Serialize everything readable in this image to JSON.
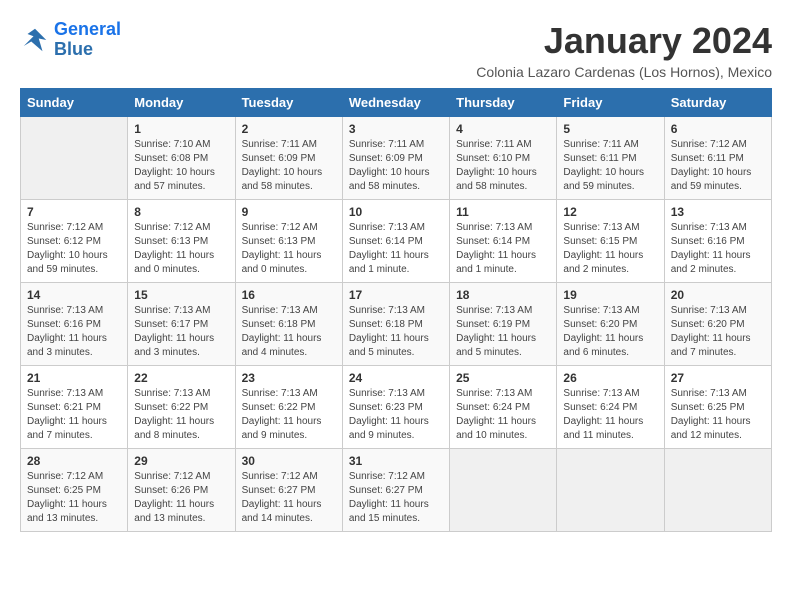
{
  "logo": {
    "line1": "General",
    "line2": "Blue"
  },
  "title": "January 2024",
  "location": "Colonia Lazaro Cardenas (Los Hornos), Mexico",
  "days_of_week": [
    "Sunday",
    "Monday",
    "Tuesday",
    "Wednesday",
    "Thursday",
    "Friday",
    "Saturday"
  ],
  "weeks": [
    [
      {
        "day": "",
        "info": ""
      },
      {
        "day": "1",
        "info": "Sunrise: 7:10 AM\nSunset: 6:08 PM\nDaylight: 10 hours\nand 57 minutes."
      },
      {
        "day": "2",
        "info": "Sunrise: 7:11 AM\nSunset: 6:09 PM\nDaylight: 10 hours\nand 58 minutes."
      },
      {
        "day": "3",
        "info": "Sunrise: 7:11 AM\nSunset: 6:09 PM\nDaylight: 10 hours\nand 58 minutes."
      },
      {
        "day": "4",
        "info": "Sunrise: 7:11 AM\nSunset: 6:10 PM\nDaylight: 10 hours\nand 58 minutes."
      },
      {
        "day": "5",
        "info": "Sunrise: 7:11 AM\nSunset: 6:11 PM\nDaylight: 10 hours\nand 59 minutes."
      },
      {
        "day": "6",
        "info": "Sunrise: 7:12 AM\nSunset: 6:11 PM\nDaylight: 10 hours\nand 59 minutes."
      }
    ],
    [
      {
        "day": "7",
        "info": "Sunrise: 7:12 AM\nSunset: 6:12 PM\nDaylight: 10 hours\nand 59 minutes."
      },
      {
        "day": "8",
        "info": "Sunrise: 7:12 AM\nSunset: 6:13 PM\nDaylight: 11 hours\nand 0 minutes."
      },
      {
        "day": "9",
        "info": "Sunrise: 7:12 AM\nSunset: 6:13 PM\nDaylight: 11 hours\nand 0 minutes."
      },
      {
        "day": "10",
        "info": "Sunrise: 7:13 AM\nSunset: 6:14 PM\nDaylight: 11 hours\nand 1 minute."
      },
      {
        "day": "11",
        "info": "Sunrise: 7:13 AM\nSunset: 6:14 PM\nDaylight: 11 hours\nand 1 minute."
      },
      {
        "day": "12",
        "info": "Sunrise: 7:13 AM\nSunset: 6:15 PM\nDaylight: 11 hours\nand 2 minutes."
      },
      {
        "day": "13",
        "info": "Sunrise: 7:13 AM\nSunset: 6:16 PM\nDaylight: 11 hours\nand 2 minutes."
      }
    ],
    [
      {
        "day": "14",
        "info": "Sunrise: 7:13 AM\nSunset: 6:16 PM\nDaylight: 11 hours\nand 3 minutes."
      },
      {
        "day": "15",
        "info": "Sunrise: 7:13 AM\nSunset: 6:17 PM\nDaylight: 11 hours\nand 3 minutes."
      },
      {
        "day": "16",
        "info": "Sunrise: 7:13 AM\nSunset: 6:18 PM\nDaylight: 11 hours\nand 4 minutes."
      },
      {
        "day": "17",
        "info": "Sunrise: 7:13 AM\nSunset: 6:18 PM\nDaylight: 11 hours\nand 5 minutes."
      },
      {
        "day": "18",
        "info": "Sunrise: 7:13 AM\nSunset: 6:19 PM\nDaylight: 11 hours\nand 5 minutes."
      },
      {
        "day": "19",
        "info": "Sunrise: 7:13 AM\nSunset: 6:20 PM\nDaylight: 11 hours\nand 6 minutes."
      },
      {
        "day": "20",
        "info": "Sunrise: 7:13 AM\nSunset: 6:20 PM\nDaylight: 11 hours\nand 7 minutes."
      }
    ],
    [
      {
        "day": "21",
        "info": "Sunrise: 7:13 AM\nSunset: 6:21 PM\nDaylight: 11 hours\nand 7 minutes."
      },
      {
        "day": "22",
        "info": "Sunrise: 7:13 AM\nSunset: 6:22 PM\nDaylight: 11 hours\nand 8 minutes."
      },
      {
        "day": "23",
        "info": "Sunrise: 7:13 AM\nSunset: 6:22 PM\nDaylight: 11 hours\nand 9 minutes."
      },
      {
        "day": "24",
        "info": "Sunrise: 7:13 AM\nSunset: 6:23 PM\nDaylight: 11 hours\nand 9 minutes."
      },
      {
        "day": "25",
        "info": "Sunrise: 7:13 AM\nSunset: 6:24 PM\nDaylight: 11 hours\nand 10 minutes."
      },
      {
        "day": "26",
        "info": "Sunrise: 7:13 AM\nSunset: 6:24 PM\nDaylight: 11 hours\nand 11 minutes."
      },
      {
        "day": "27",
        "info": "Sunrise: 7:13 AM\nSunset: 6:25 PM\nDaylight: 11 hours\nand 12 minutes."
      }
    ],
    [
      {
        "day": "28",
        "info": "Sunrise: 7:12 AM\nSunset: 6:25 PM\nDaylight: 11 hours\nand 13 minutes."
      },
      {
        "day": "29",
        "info": "Sunrise: 7:12 AM\nSunset: 6:26 PM\nDaylight: 11 hours\nand 13 minutes."
      },
      {
        "day": "30",
        "info": "Sunrise: 7:12 AM\nSunset: 6:27 PM\nDaylight: 11 hours\nand 14 minutes."
      },
      {
        "day": "31",
        "info": "Sunrise: 7:12 AM\nSunset: 6:27 PM\nDaylight: 11 hours\nand 15 minutes."
      },
      {
        "day": "",
        "info": ""
      },
      {
        "day": "",
        "info": ""
      },
      {
        "day": "",
        "info": ""
      }
    ]
  ]
}
